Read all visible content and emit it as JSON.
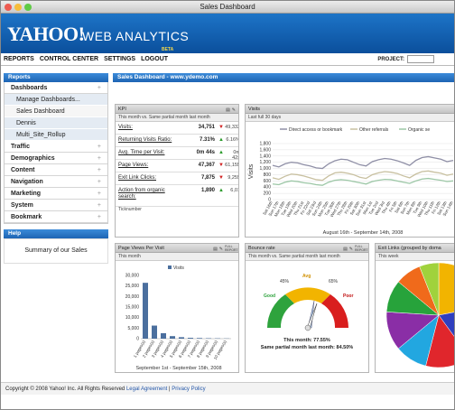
{
  "window": {
    "title": "Sales Dashboard"
  },
  "header": {
    "logo": "YAHOO!",
    "product": "WEB ANALYTICS",
    "beta": "BETA"
  },
  "menubar": {
    "items": [
      "REPORTS",
      "CONTROL CENTER",
      "SETTINGS",
      "LOGOUT"
    ],
    "project_label": "PROJECT:"
  },
  "reports_panel": {
    "title": "Reports",
    "dashboards_label": "Dashboards",
    "dashboard_items": [
      "Manage Dashboards...",
      "Sales Dashboard",
      "Dennis",
      "Multi_Site_Rollup"
    ],
    "sections": [
      "Traffic",
      "Demographics",
      "Content",
      "Navigation",
      "Marketing",
      "System",
      "Bookmark"
    ]
  },
  "help_panel": {
    "title": "Help",
    "text": "Summary of our Sales"
  },
  "main": {
    "title": "Sales Dashboard - www.ydemo.com"
  },
  "kpi": {
    "title": "KPI",
    "subtitle": "This month vs. Same partial month last month",
    "rows": [
      {
        "label": "Visits:",
        "value": "34,751",
        "direction": "down",
        "compare": "49,333"
      },
      {
        "label": "Returning Visits Ratio:",
        "value": "7.31%",
        "direction": "up",
        "compare": "6.16%"
      },
      {
        "label": "Avg. Time per Visit:",
        "value": "0m 44s",
        "direction": "up",
        "compare": "0m 42s"
      },
      {
        "label": "Page Views:",
        "value": "47,367",
        "direction": "down",
        "compare": "61,155"
      },
      {
        "label": "Exit Link Clicks:",
        "value": "7,875",
        "direction": "down",
        "compare": "9,255"
      },
      {
        "label": "Action from organic search:",
        "value": "1,890",
        "direction": "up",
        "compare": "6,01"
      }
    ],
    "extra_label": "Ticknumber"
  },
  "visits": {
    "title": "Visits",
    "subtitle": "Last full 30 days",
    "legend": [
      "Direct access or bookmark",
      "Other referrals",
      "Organic se"
    ],
    "ylabel": "Visits",
    "xcaption": "August 16th - September 14th, 2008"
  },
  "pageviews": {
    "title": "Page Views Per Visit",
    "subtitle": "This month",
    "legend": "Visits",
    "xcaption": "September 1st - September 15th, 2008",
    "icon_text": "FULL REPORT"
  },
  "bounce": {
    "title": "Bounce rate",
    "subtitle": "This month vs. Same partial month last month",
    "labels": {
      "good": "Good",
      "avg": "Avg",
      "poor": "Poor",
      "pct45": "45%",
      "pct65": "65%"
    },
    "this_month": "This month: 77.55%",
    "last_month": "Same partial month last month: 84.50%",
    "icon_text": "FULL REPORT"
  },
  "exitlinks": {
    "title": "Exit Links (grouped by doma",
    "subtitle": "This week"
  },
  "footer": {
    "text": "Copyright © 2008 Yahoo! Inc. All Rights Reserved",
    "link1": "Legal Agreement",
    "sep": " | ",
    "link2": "Privacy Policy"
  },
  "chart_data": [
    {
      "type": "line",
      "title": "Visits",
      "ylabel": "Visits",
      "ylim": [
        0,
        1800
      ],
      "yticks": [
        "1,800",
        "1,600",
        "1,400",
        "1,200",
        "1,000",
        "800",
        "600",
        "400",
        "200",
        "0"
      ],
      "categories": [
        "Sat 16th",
        "Sun 17th",
        "Mon 18th",
        "Tue 19th",
        "Wed 20th",
        "Thu 21st",
        "Fri 22nd",
        "Sat 23rd",
        "Sun 24th",
        "Mon 25th",
        "Tue 26th",
        "Wed 27th",
        "Thu 28th",
        "Fri 29th",
        "Sat 30th",
        "Sun 31st",
        "Mon 1st",
        "Tue 2nd",
        "Wed 3rd",
        "Thu 4th",
        "Fri 5th",
        "Sat 6th",
        "Sun 7th",
        "Mon 8th",
        "Tue 9th",
        "Wed 10th",
        "Thu 11th",
        "Fri 12th",
        "Sat 13th",
        "Sun 14th"
      ],
      "series": [
        {
          "name": "Direct access or bookmark",
          "color": "#8f8fa6",
          "values": [
            1100,
            1050,
            1150,
            1200,
            1180,
            1120,
            1080,
            1020,
            1000,
            1150,
            1250,
            1300,
            1280,
            1200,
            1120,
            1080,
            1220,
            1280,
            1320,
            1300,
            1250,
            1180,
            1100,
            1260,
            1350,
            1380,
            1340,
            1300,
            1220,
            1260
          ]
        },
        {
          "name": "Other referrals",
          "color": "#c8c0a0",
          "values": [
            700,
            650,
            750,
            820,
            800,
            760,
            700,
            640,
            620,
            760,
            860,
            880,
            850,
            800,
            720,
            680,
            800,
            860,
            900,
            880,
            840,
            760,
            700,
            820,
            900,
            920,
            880,
            850,
            780,
            820
          ]
        },
        {
          "name": "Organic se",
          "color": "#9cc7a6",
          "values": [
            500,
            480,
            560,
            600,
            580,
            540,
            520,
            480,
            460,
            560,
            620,
            640,
            620,
            580,
            540,
            500,
            580,
            620,
            650,
            640,
            600,
            560,
            520,
            600,
            660,
            680,
            650,
            620,
            580,
            600
          ]
        }
      ]
    },
    {
      "type": "bar",
      "title": "Page Views Per Visit",
      "legend": "Visits",
      "ylim": [
        0,
        30000
      ],
      "yticks": [
        "30,000",
        "25,000",
        "20,000",
        "15,000",
        "10,000",
        "5,000",
        "0"
      ],
      "categories": [
        "1 pages(s)",
        "2 pages(s)",
        "3 pages(s)",
        "4 pages(s)",
        "5 pages(s)",
        "6 pages(s)",
        "7 pages(s)",
        "8 pages(s)",
        "9 pages(s)",
        "10 pages(s)"
      ],
      "values": [
        26500,
        6200,
        2600,
        1200,
        700,
        400,
        300,
        200,
        150,
        100
      ],
      "color": "#4b6f9e"
    },
    {
      "type": "pie",
      "title": "Exit Links (grouped by doma",
      "slices": [
        {
          "value": 22,
          "color": "#f2b400"
        },
        {
          "value": 18,
          "color": "#2f3fbf"
        },
        {
          "value": 14,
          "color": "#e0262c"
        },
        {
          "value": 10,
          "color": "#22a7e0"
        },
        {
          "value": 12,
          "color": "#8a2ea6"
        },
        {
          "value": 10,
          "color": "#27a33b"
        },
        {
          "value": 8,
          "color": "#f06a1b"
        },
        {
          "value": 6,
          "color": "#a0d23c"
        }
      ]
    }
  ]
}
